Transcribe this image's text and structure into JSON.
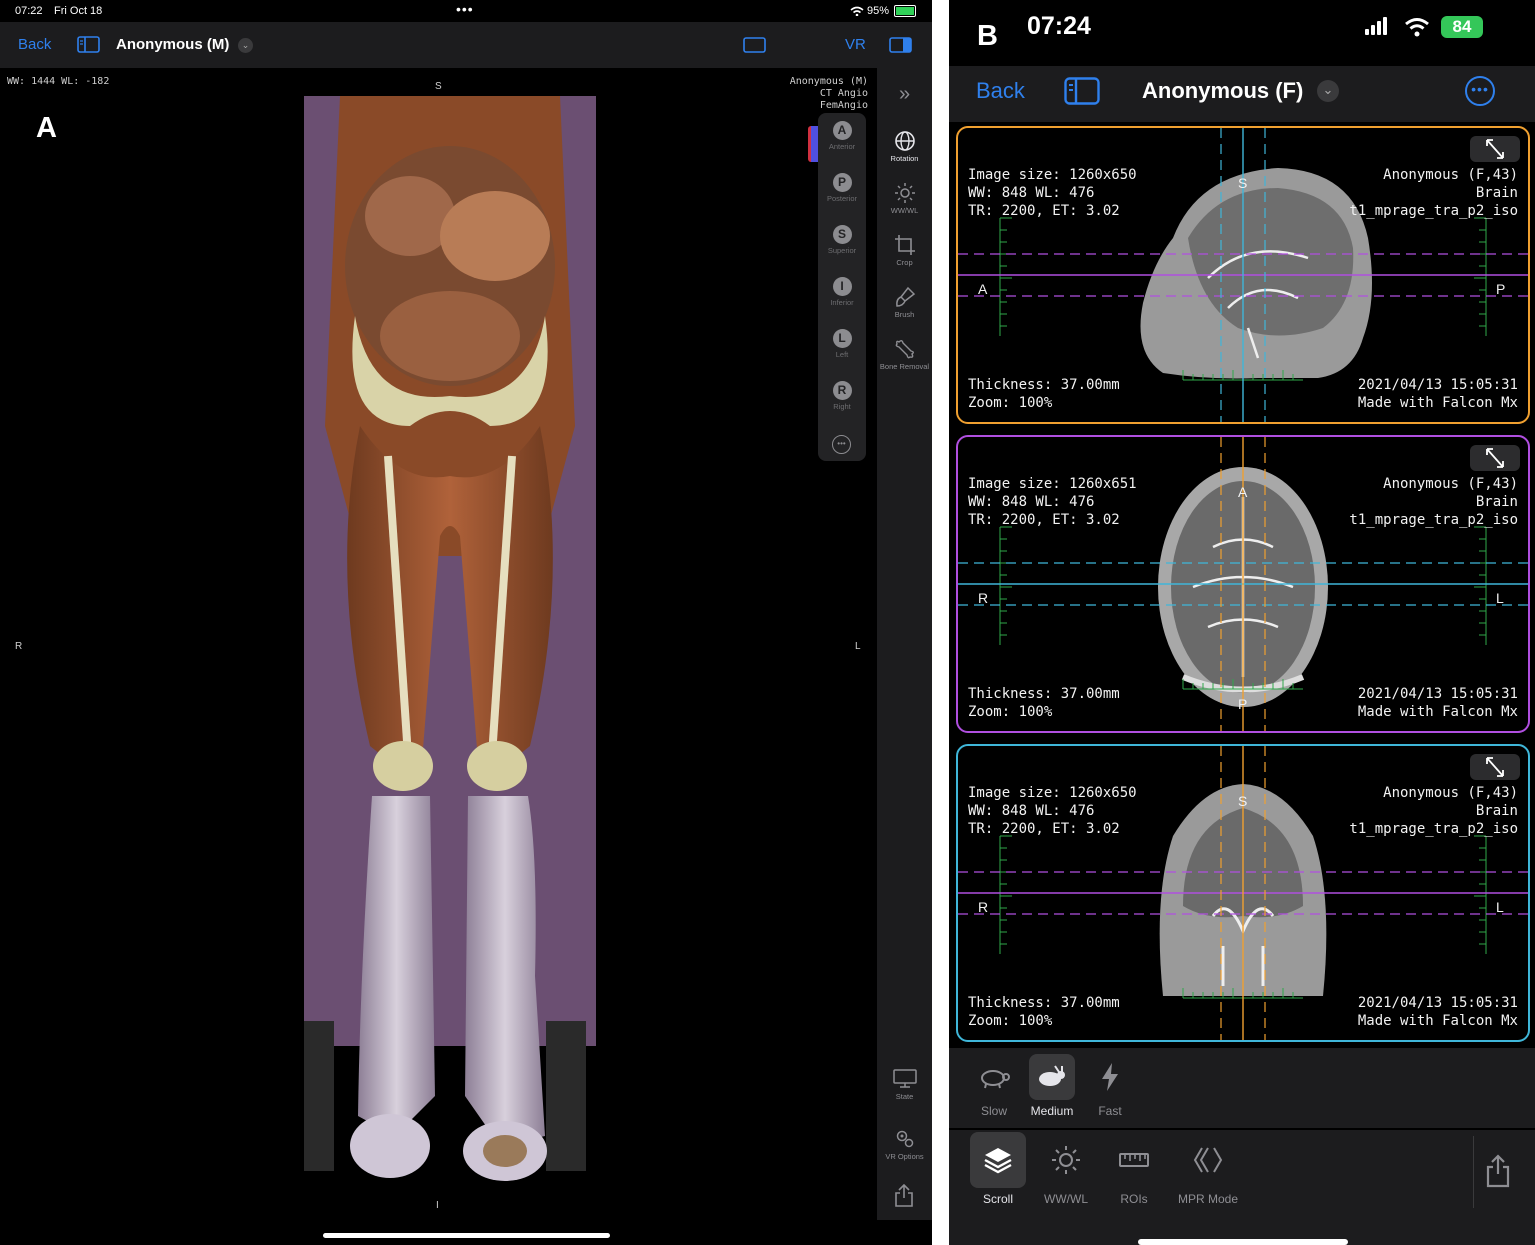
{
  "panel_a": {
    "label": "A",
    "status": {
      "time": "07:22",
      "date": "Fri Oct 18",
      "battery": "95%"
    },
    "nav": {
      "back": "Back",
      "patient": "Anonymous (M)",
      "mode": "VR"
    },
    "overlay": {
      "wwwl": "WW: 1444 WL: -182",
      "patient_name": "Anonymous (M)",
      "study_line1": "CT Angio",
      "study_line2": "FemAngio",
      "top": "S",
      "bottom": "I",
      "left": "R",
      "right": "L"
    },
    "orientation_buttons": [
      {
        "letter": "A",
        "label": "Anterior"
      },
      {
        "letter": "P",
        "label": "Posterior"
      },
      {
        "letter": "S",
        "label": "Superior"
      },
      {
        "letter": "I",
        "label": "Inferior"
      },
      {
        "letter": "L",
        "label": "Left"
      },
      {
        "letter": "R",
        "label": "Right"
      }
    ],
    "tools": [
      {
        "label": "Rotation",
        "icon": "rotation-icon"
      },
      {
        "label": "WW/WL",
        "icon": "brightness-icon"
      },
      {
        "label": "Crop",
        "icon": "crop-icon"
      },
      {
        "label": "Brush",
        "icon": "brush-icon"
      },
      {
        "label": "Bone Removal",
        "icon": "bone-icon"
      }
    ],
    "bottom_tools": [
      {
        "label": "State",
        "icon": "monitor-icon"
      },
      {
        "label": "VR Options",
        "icon": "gears-icon"
      }
    ]
  },
  "panel_b": {
    "label": "B",
    "status": {
      "time": "07:24",
      "battery": "84"
    },
    "nav": {
      "back": "Back",
      "patient": "Anonymous (F)"
    },
    "viewports": [
      {
        "border_color": "#f0a030",
        "image_size": "Image size: 1260x650",
        "wwwl": "WW: 848 WL: 476",
        "tr_et": "TR: 2200, ET: 3.02",
        "thickness": "Thickness: 37.00mm",
        "zoom": "Zoom: 100%",
        "patient": "Anonymous (F,43)",
        "body_part": "Brain",
        "series": "t1_mprage_tra_p2_iso",
        "datetime": "2021/04/13 15:05:31",
        "made_with": "Made with Falcon Mx",
        "top": "S",
        "left": "A",
        "right": "P"
      },
      {
        "border_color": "#b04fe0",
        "image_size": "Image size: 1260x651",
        "wwwl": "WW: 848 WL: 476",
        "tr_et": "TR: 2200, ET: 3.02",
        "thickness": "Thickness: 37.00mm",
        "zoom": "Zoom: 100%",
        "patient": "Anonymous (F,43)",
        "body_part": "Brain",
        "series": "t1_mprage_tra_p2_iso",
        "datetime": "2021/04/13 15:05:31",
        "made_with": "Made with Falcon Mx",
        "top": "A",
        "bottom": "P",
        "left": "R",
        "right": "L"
      },
      {
        "border_color": "#3fb6d9",
        "image_size": "Image size: 1260x650",
        "wwwl": "WW: 848 WL: 476",
        "tr_et": "TR: 2200, ET: 3.02",
        "thickness": "Thickness: 37.00mm",
        "zoom": "Zoom: 100%",
        "patient": "Anonymous (F,43)",
        "body_part": "Brain",
        "series": "t1_mprage_tra_p2_iso",
        "datetime": "2021/04/13 15:05:31",
        "made_with": "Made with Falcon Mx",
        "top": "S",
        "left": "R",
        "right": "L"
      }
    ],
    "speed": [
      {
        "label": "Slow",
        "icon": "turtle-icon",
        "selected": false
      },
      {
        "label": "Medium",
        "icon": "rabbit-icon",
        "selected": true
      },
      {
        "label": "Fast",
        "icon": "bolt-icon",
        "selected": false
      }
    ],
    "tools": [
      {
        "label": "Scroll",
        "icon": "layers-icon",
        "selected": true
      },
      {
        "label": "WW/WL",
        "icon": "brightness-icon",
        "selected": false
      },
      {
        "label": "ROIs",
        "icon": "ruler-icon",
        "selected": false
      },
      {
        "label": "MPR Mode",
        "icon": "mpr-icon",
        "selected": false
      }
    ]
  }
}
